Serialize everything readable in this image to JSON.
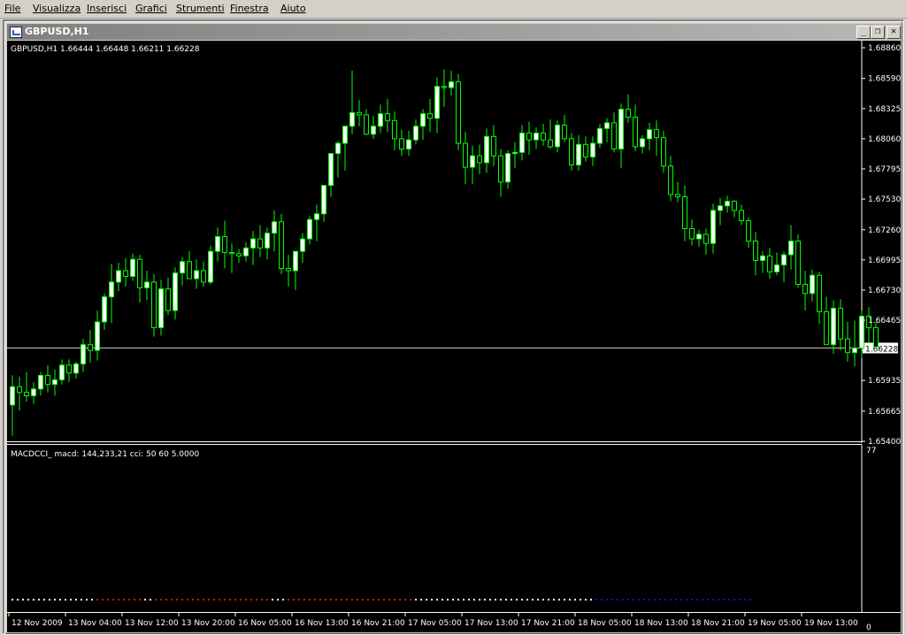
{
  "menu": [
    "File",
    "Visualizza",
    "Inserisci",
    "Grafici",
    "Strumenti",
    "Finestra",
    "Aiuto"
  ],
  "window": {
    "title": "GBPUSD,H1",
    "minimize_glyph": "_",
    "restore_glyph": "❐",
    "close_glyph": "✕"
  },
  "chart": {
    "price_header": "GBPUSD,H1  1.66444 1.66448 1.66211 1.66228",
    "current_price_label": "1.66228",
    "current_price": 1.66228,
    "y_ticks": [
      "1.68860",
      "1.68590",
      "1.68325",
      "1.68060",
      "1.67795",
      "1.67530",
      "1.67260",
      "1.66995",
      "1.66730",
      "1.66465",
      "1.66200",
      "1.65935",
      "1.65665",
      "1.65400"
    ],
    "x_ticks": [
      "12 Nov 2009",
      "13 Nov 04:00",
      "13 Nov 12:00",
      "13 Nov 20:00",
      "16 Nov 05:00",
      "16 Nov 13:00",
      "16 Nov 21:00",
      "17 Nov 05:00",
      "17 Nov 13:00",
      "17 Nov 21:00",
      "18 Nov 05:00",
      "18 Nov 13:00",
      "18 Nov 21:00",
      "19 Nov 05:00",
      "19 Nov 13:00"
    ],
    "colors": {
      "bull": "#ffffff",
      "bear": "#000000",
      "wick": "#00ff00",
      "bid_line": "#c0c0c0",
      "background": "#000000",
      "text": "#ffffff"
    }
  },
  "indicator": {
    "label": "MACDCCI_ macd: 144,233,21 cci: 50 60 5.0000",
    "y_top": "77",
    "y_bottom": "0",
    "dot_segments": [
      {
        "color": "#ffffff",
        "count": 16
      },
      {
        "color": "#e01010",
        "count": 9
      },
      {
        "color": "#ffffff",
        "count": 2
      },
      {
        "color": "#e01010",
        "count": 22
      },
      {
        "color": "#ffffff",
        "count": 3
      },
      {
        "color": "#e01010",
        "count": 24
      },
      {
        "color": "#ffffff",
        "count": 34
      },
      {
        "color": "#1010e0",
        "count": 30
      }
    ]
  },
  "chart_data": {
    "type": "candlestick",
    "symbol": "GBPUSD",
    "timeframe": "H1",
    "ylim": [
      1.654,
      1.6886
    ],
    "candles": [
      [
        1.6572,
        1.6598,
        1.6545,
        1.6588
      ],
      [
        1.6588,
        1.6597,
        1.6567,
        1.6583
      ],
      [
        1.6583,
        1.6601,
        1.6575,
        1.658
      ],
      [
        1.658,
        1.6592,
        1.6573,
        1.6586
      ],
      [
        1.6586,
        1.6601,
        1.658,
        1.6598
      ],
      [
        1.6598,
        1.6607,
        1.6583,
        1.659
      ],
      [
        1.659,
        1.6603,
        1.658,
        1.6594
      ],
      [
        1.6594,
        1.6612,
        1.659,
        1.6607
      ],
      [
        1.6607,
        1.6612,
        1.6592,
        1.66
      ],
      [
        1.66,
        1.661,
        1.6595,
        1.6608
      ],
      [
        1.6608,
        1.663,
        1.6601,
        1.6625
      ],
      [
        1.6625,
        1.6638,
        1.6609,
        1.662
      ],
      [
        1.662,
        1.6655,
        1.6611,
        1.6645
      ],
      [
        1.6645,
        1.667,
        1.6638,
        1.6667
      ],
      [
        1.6667,
        1.6696,
        1.6644,
        1.668
      ],
      [
        1.668,
        1.6697,
        1.6672,
        1.669
      ],
      [
        1.669,
        1.6701,
        1.6676,
        1.6685
      ],
      [
        1.6685,
        1.6705,
        1.6681,
        1.67
      ],
      [
        1.67,
        1.6704,
        1.6662,
        1.6675
      ],
      [
        1.6675,
        1.669,
        1.6664,
        1.668
      ],
      [
        1.668,
        1.6687,
        1.6632,
        1.664
      ],
      [
        1.664,
        1.6682,
        1.6633,
        1.6674
      ],
      [
        1.6674,
        1.6684,
        1.6651,
        1.6655
      ],
      [
        1.6655,
        1.6693,
        1.6647,
        1.6688
      ],
      [
        1.6688,
        1.6702,
        1.6677,
        1.6698
      ],
      [
        1.6698,
        1.6707,
        1.6686,
        1.6683
      ],
      [
        1.6683,
        1.67,
        1.6674,
        1.669
      ],
      [
        1.669,
        1.6698,
        1.6676,
        1.668
      ],
      [
        1.668,
        1.6712,
        1.6678,
        1.6707
      ],
      [
        1.6707,
        1.6728,
        1.6698,
        1.672
      ],
      [
        1.672,
        1.6734,
        1.6692,
        1.6706
      ],
      [
        1.6706,
        1.6714,
        1.6688,
        1.6705
      ],
      [
        1.6705,
        1.6709,
        1.6697,
        1.6703
      ],
      [
        1.6703,
        1.6715,
        1.6698,
        1.671
      ],
      [
        1.671,
        1.6725,
        1.6695,
        1.6718
      ],
      [
        1.6718,
        1.673,
        1.6702,
        1.671
      ],
      [
        1.671,
        1.6728,
        1.67,
        1.6723
      ],
      [
        1.6723,
        1.6743,
        1.6707,
        1.6733
      ],
      [
        1.6733,
        1.674,
        1.6687,
        1.6692
      ],
      [
        1.6692,
        1.6704,
        1.6676,
        1.669
      ],
      [
        1.669,
        1.6707,
        1.6673,
        1.6707
      ],
      [
        1.6707,
        1.6723,
        1.6697,
        1.6718
      ],
      [
        1.6718,
        1.6738,
        1.6713,
        1.6735
      ],
      [
        1.6735,
        1.6748,
        1.6716,
        1.674
      ],
      [
        1.674,
        1.6765,
        1.6733,
        1.6765
      ],
      [
        1.6765,
        1.6793,
        1.6755,
        1.6793
      ],
      [
        1.6793,
        1.6804,
        1.6772,
        1.6802
      ],
      [
        1.6802,
        1.6817,
        1.6778,
        1.6817
      ],
      [
        1.6817,
        1.6866,
        1.681,
        1.6829
      ],
      [
        1.6829,
        1.684,
        1.6817,
        1.6827
      ],
      [
        1.6827,
        1.6832,
        1.6809,
        1.681
      ],
      [
        1.681,
        1.6826,
        1.6806,
        1.6817
      ],
      [
        1.6817,
        1.6836,
        1.6811,
        1.6828
      ],
      [
        1.6828,
        1.6841,
        1.6812,
        1.6822
      ],
      [
        1.6822,
        1.683,
        1.6796,
        1.6806
      ],
      [
        1.6806,
        1.6814,
        1.6791,
        1.6797
      ],
      [
        1.6797,
        1.6813,
        1.6791,
        1.6805
      ],
      [
        1.6805,
        1.6823,
        1.6801,
        1.6817
      ],
      [
        1.6817,
        1.6832,
        1.6805,
        1.6828
      ],
      [
        1.6828,
        1.6841,
        1.6812,
        1.6824
      ],
      [
        1.6824,
        1.686,
        1.6811,
        1.6852
      ],
      [
        1.6852,
        1.6867,
        1.6834,
        1.6851
      ],
      [
        1.6851,
        1.6866,
        1.6844,
        1.6856
      ],
      [
        1.6856,
        1.6863,
        1.6796,
        1.6802
      ],
      [
        1.6802,
        1.6812,
        1.6766,
        1.6781
      ],
      [
        1.6781,
        1.68,
        1.6766,
        1.6791
      ],
      [
        1.6791,
        1.6801,
        1.6775,
        1.6785
      ],
      [
        1.6785,
        1.6815,
        1.6776,
        1.6808
      ],
      [
        1.6808,
        1.6818,
        1.6782,
        1.6791
      ],
      [
        1.6791,
        1.6797,
        1.6755,
        1.6768
      ],
      [
        1.6768,
        1.6796,
        1.6762,
        1.6793
      ],
      [
        1.6793,
        1.6803,
        1.678,
        1.6794
      ],
      [
        1.6794,
        1.6818,
        1.6787,
        1.6811
      ],
      [
        1.6811,
        1.6821,
        1.6792,
        1.6805
      ],
      [
        1.6805,
        1.6816,
        1.6797,
        1.6811
      ],
      [
        1.6811,
        1.6819,
        1.68,
        1.6805
      ],
      [
        1.6805,
        1.6823,
        1.6797,
        1.6799
      ],
      [
        1.6799,
        1.6822,
        1.6794,
        1.6818
      ],
      [
        1.6818,
        1.6827,
        1.6803,
        1.6806
      ],
      [
        1.6806,
        1.6811,
        1.6778,
        1.6783
      ],
      [
        1.6783,
        1.6809,
        1.6778,
        1.6801
      ],
      [
        1.6801,
        1.6808,
        1.6786,
        1.679
      ],
      [
        1.679,
        1.6808,
        1.6782,
        1.6802
      ],
      [
        1.6802,
        1.6819,
        1.6798,
        1.6815
      ],
      [
        1.6815,
        1.6824,
        1.6803,
        1.682
      ],
      [
        1.682,
        1.6829,
        1.6794,
        1.6797
      ],
      [
        1.6797,
        1.6837,
        1.678,
        1.6832
      ],
      [
        1.6832,
        1.6845,
        1.682,
        1.6825
      ],
      [
        1.6825,
        1.6836,
        1.6795,
        1.6799
      ],
      [
        1.6799,
        1.6809,
        1.6793,
        1.6806
      ],
      [
        1.6806,
        1.682,
        1.6796,
        1.6814
      ],
      [
        1.6814,
        1.6822,
        1.6791,
        1.6807
      ],
      [
        1.6807,
        1.6813,
        1.6776,
        1.6782
      ],
      [
        1.6782,
        1.6791,
        1.6751,
        1.6757
      ],
      [
        1.6757,
        1.6768,
        1.675,
        1.6755
      ],
      [
        1.6755,
        1.6765,
        1.6716,
        1.6727
      ],
      [
        1.6727,
        1.6735,
        1.6712,
        1.6718
      ],
      [
        1.6718,
        1.6726,
        1.6711,
        1.6722
      ],
      [
        1.6722,
        1.6727,
        1.6704,
        1.6714
      ],
      [
        1.6714,
        1.6749,
        1.6705,
        1.6743
      ],
      [
        1.6743,
        1.6754,
        1.673,
        1.6747
      ],
      [
        1.6747,
        1.6756,
        1.6741,
        1.6751
      ],
      [
        1.6751,
        1.6752,
        1.6737,
        1.6743
      ],
      [
        1.6743,
        1.6748,
        1.673,
        1.6734
      ],
      [
        1.6734,
        1.6737,
        1.671,
        1.6716
      ],
      [
        1.6716,
        1.6724,
        1.6686,
        1.6699
      ],
      [
        1.6699,
        1.6707,
        1.6688,
        1.6703
      ],
      [
        1.6703,
        1.671,
        1.6683,
        1.6689
      ],
      [
        1.6689,
        1.6706,
        1.6686,
        1.6695
      ],
      [
        1.6695,
        1.6707,
        1.668,
        1.6704
      ],
      [
        1.6704,
        1.673,
        1.6691,
        1.6716
      ],
      [
        1.6716,
        1.6722,
        1.6675,
        1.6678
      ],
      [
        1.6678,
        1.669,
        1.6655,
        1.667
      ],
      [
        1.667,
        1.6691,
        1.6663,
        1.6686
      ],
      [
        1.6686,
        1.6689,
        1.6643,
        1.6654
      ],
      [
        1.6654,
        1.6667,
        1.6632,
        1.6625
      ],
      [
        1.6625,
        1.6664,
        1.6617,
        1.6657
      ],
      [
        1.6657,
        1.6665,
        1.662,
        1.663
      ],
      [
        1.663,
        1.6645,
        1.661,
        1.6618
      ],
      [
        1.6618,
        1.6646,
        1.6606,
        1.6622
      ],
      [
        1.6622,
        1.6655,
        1.6613,
        1.665
      ],
      [
        1.665,
        1.6658,
        1.6627,
        1.664
      ],
      [
        1.664,
        1.6645,
        1.6621,
        1.6623
      ]
    ]
  }
}
